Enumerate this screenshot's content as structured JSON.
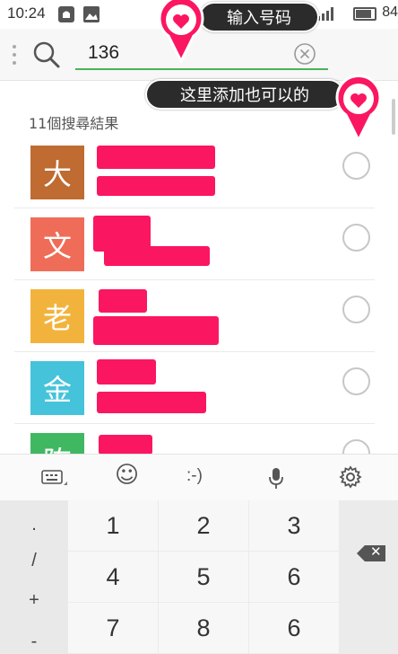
{
  "status_bar": {
    "time": "10:24",
    "battery": "84"
  },
  "search": {
    "value": "136"
  },
  "results": {
    "count_label": "11個搜尋結果",
    "contacts": [
      {
        "initial": "大",
        "color": "#bf6b32"
      },
      {
        "initial": "文",
        "color": "#ef6d58"
      },
      {
        "initial": "老",
        "color": "#f2b33d"
      },
      {
        "initial": "金",
        "color": "#45c3da"
      },
      {
        "initial": "陈",
        "color": "#3fb861"
      }
    ]
  },
  "keyboard": {
    "toolbar": {
      "emoji": "☺",
      "emoticon": ":-)"
    },
    "side_keys": [
      ".",
      "/",
      "+",
      "-"
    ],
    "keys": [
      "1",
      "2",
      "3",
      "4",
      "5",
      "6",
      "7",
      "8",
      "6"
    ]
  },
  "annotations": {
    "top": "输入号码",
    "second": "这里添加也可以的"
  },
  "colors": {
    "accent": "#48b35a",
    "highlight": "#fb1661"
  }
}
